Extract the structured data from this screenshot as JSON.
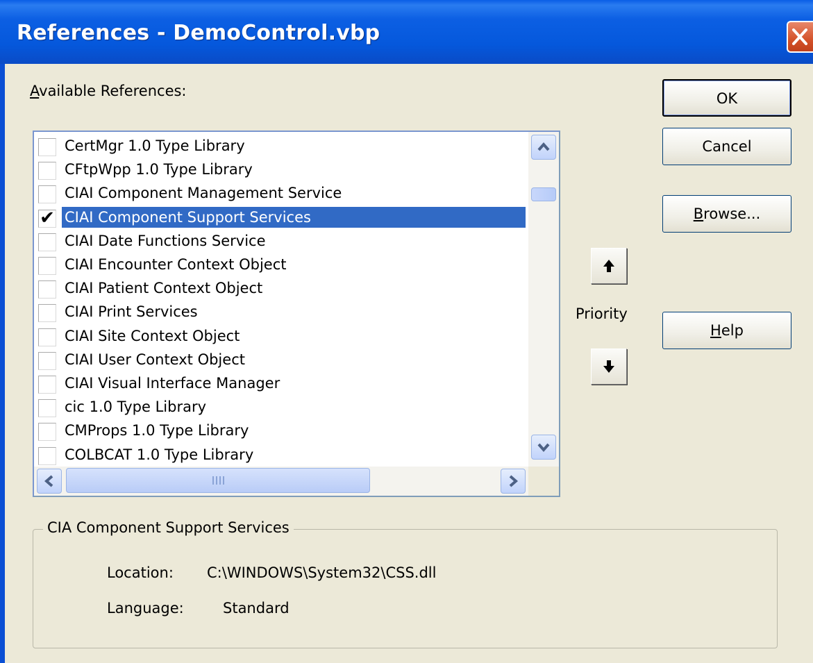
{
  "window": {
    "title": "References - DemoControl.vbp"
  },
  "available_label": {
    "underlined": "A",
    "rest": "vailable References:"
  },
  "references": [
    {
      "name": "CertMgr 1.0 Type Library",
      "checked": false,
      "selected": false
    },
    {
      "name": "CFtpWpp 1.0 Type Library",
      "checked": false,
      "selected": false
    },
    {
      "name": "CIAI Component Management Service",
      "checked": false,
      "selected": false
    },
    {
      "name": "CIAI Component Support Services",
      "checked": true,
      "selected": true
    },
    {
      "name": "CIAI Date Functions Service",
      "checked": false,
      "selected": false
    },
    {
      "name": "CIAI Encounter Context Object",
      "checked": false,
      "selected": false
    },
    {
      "name": "CIAI Patient Context Object",
      "checked": false,
      "selected": false
    },
    {
      "name": "CIAI Print Services",
      "checked": false,
      "selected": false
    },
    {
      "name": "CIAI Site Context Object",
      "checked": false,
      "selected": false
    },
    {
      "name": "CIAI User Context Object",
      "checked": false,
      "selected": false
    },
    {
      "name": "CIAI Visual Interface Manager",
      "checked": false,
      "selected": false
    },
    {
      "name": "cic 1.0 Type Library",
      "checked": false,
      "selected": false
    },
    {
      "name": "CMProps 1.0 Type Library",
      "checked": false,
      "selected": false
    },
    {
      "name": "COLBCAT 1.0 Type Library",
      "checked": false,
      "selected": false
    }
  ],
  "buttons": {
    "ok": "OK",
    "cancel": "Cancel",
    "browse": {
      "underlined": "B",
      "rest": "rowse..."
    },
    "help": {
      "underlined": "H",
      "rest": "elp"
    }
  },
  "priority_label": "Priority",
  "check_glyph": "✔",
  "details": {
    "group_title": "CIA Component Support Services",
    "location_label": "Location:",
    "location_value": "C:\\WINDOWS\\System32\\CSS.dll",
    "language_label": "Language:",
    "language_value": "Standard"
  },
  "icons": {
    "close": "close-icon",
    "scroll_up": "scroll-up-icon",
    "scroll_down": "scroll-down-icon",
    "scroll_left": "scroll-left-icon",
    "scroll_right": "scroll-right-icon",
    "priority_up": "arrow-up-icon",
    "priority_down": "arrow-down-icon"
  },
  "colors": {
    "titlebar": "#0558dc",
    "selection": "#316ac5",
    "dialog_bg": "#ece9d8",
    "close_button": "#d4522a"
  }
}
